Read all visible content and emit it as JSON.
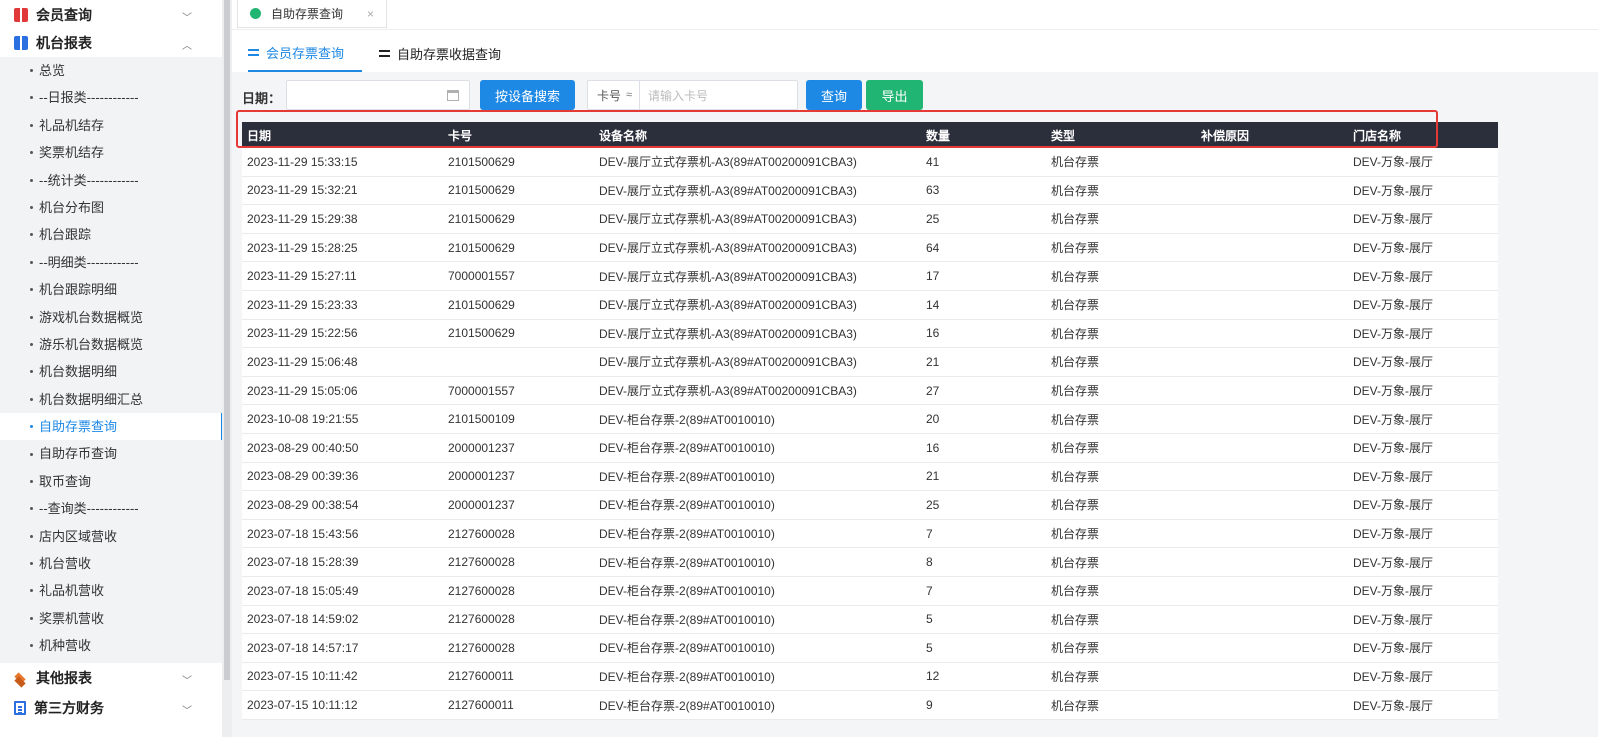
{
  "sidebar": {
    "groups": [
      {
        "label": "会员查询",
        "icon": "red-book-icon",
        "expanded": false
      },
      {
        "label": "机台报表",
        "icon": "blue-book-icon",
        "expanded": true
      },
      {
        "label": "其他报表",
        "icon": "layers-icon",
        "expanded": false
      },
      {
        "label": "第三方财务",
        "icon": "document-icon",
        "expanded": false
      }
    ],
    "items": [
      "总览",
      "--日报类------------",
      "礼品机结存",
      "奖票机结存",
      "--统计类------------",
      "机台分布图",
      "机台跟踪",
      "--明细类------------",
      "机台跟踪明细",
      "游戏机台数据概览",
      "游乐机台数据概览",
      "机台数据明细",
      "机台数据明细汇总",
      "自助存票查询",
      "自助存币查询",
      "取币查询",
      "--查询类------------",
      "店内区域营收",
      "机台营收",
      "礼品机营收",
      "奖票机营收",
      "机种营收"
    ],
    "active_item": "自助存票查询"
  },
  "page_tab": {
    "label": "自助存票查询",
    "close": "×"
  },
  "subtabs": [
    {
      "label": "会员存票查询",
      "active": true
    },
    {
      "label": "自助存票收据查询",
      "active": false
    }
  ],
  "filters": {
    "date_label": "日期：",
    "date_value": "",
    "device_search_button": "按设备搜索",
    "card_select": "卡号",
    "card_select_symbol": "≈",
    "card_placeholder": "请输入卡号",
    "query_button": "查询",
    "export_button": "导出"
  },
  "table": {
    "columns": [
      "日期",
      "卡号",
      "设备名称",
      "数量",
      "类型",
      "补偿原因",
      "门店名称"
    ],
    "rows": [
      [
        "2023-11-29 15:33:15",
        "2101500629",
        "DEV-展厅立式存票机-A3(89#AT00200091CBA3)",
        "41",
        "机台存票",
        "",
        "DEV-万象-展厅"
      ],
      [
        "2023-11-29 15:32:21",
        "2101500629",
        "DEV-展厅立式存票机-A3(89#AT00200091CBA3)",
        "63",
        "机台存票",
        "",
        "DEV-万象-展厅"
      ],
      [
        "2023-11-29 15:29:38",
        "2101500629",
        "DEV-展厅立式存票机-A3(89#AT00200091CBA3)",
        "25",
        "机台存票",
        "",
        "DEV-万象-展厅"
      ],
      [
        "2023-11-29 15:28:25",
        "2101500629",
        "DEV-展厅立式存票机-A3(89#AT00200091CBA3)",
        "64",
        "机台存票",
        "",
        "DEV-万象-展厅"
      ],
      [
        "2023-11-29 15:27:11",
        "7000001557",
        "DEV-展厅立式存票机-A3(89#AT00200091CBA3)",
        "17",
        "机台存票",
        "",
        "DEV-万象-展厅"
      ],
      [
        "2023-11-29 15:23:33",
        "2101500629",
        "DEV-展厅立式存票机-A3(89#AT00200091CBA3)",
        "14",
        "机台存票",
        "",
        "DEV-万象-展厅"
      ],
      [
        "2023-11-29 15:22:56",
        "2101500629",
        "DEV-展厅立式存票机-A3(89#AT00200091CBA3)",
        "16",
        "机台存票",
        "",
        "DEV-万象-展厅"
      ],
      [
        "2023-11-29 15:06:48",
        "",
        "DEV-展厅立式存票机-A3(89#AT00200091CBA3)",
        "21",
        "机台存票",
        "",
        "DEV-万象-展厅"
      ],
      [
        "2023-11-29 15:05:06",
        "7000001557",
        "DEV-展厅立式存票机-A3(89#AT00200091CBA3)",
        "27",
        "机台存票",
        "",
        "DEV-万象-展厅"
      ],
      [
        "2023-10-08 19:21:55",
        "2101500109",
        "DEV-柜台存票-2(89#AT0010010)",
        "20",
        "机台存票",
        "",
        "DEV-万象-展厅"
      ],
      [
        "2023-08-29 00:40:50",
        "2000001237",
        "DEV-柜台存票-2(89#AT0010010)",
        "16",
        "机台存票",
        "",
        "DEV-万象-展厅"
      ],
      [
        "2023-08-29 00:39:36",
        "2000001237",
        "DEV-柜台存票-2(89#AT0010010)",
        "21",
        "机台存票",
        "",
        "DEV-万象-展厅"
      ],
      [
        "2023-08-29 00:38:54",
        "2000001237",
        "DEV-柜台存票-2(89#AT0010010)",
        "25",
        "机台存票",
        "",
        "DEV-万象-展厅"
      ],
      [
        "2023-07-18 15:43:56",
        "2127600028",
        "DEV-柜台存票-2(89#AT0010010)",
        "7",
        "机台存票",
        "",
        "DEV-万象-展厅"
      ],
      [
        "2023-07-18 15:28:39",
        "2127600028",
        "DEV-柜台存票-2(89#AT0010010)",
        "8",
        "机台存票",
        "",
        "DEV-万象-展厅"
      ],
      [
        "2023-07-18 15:05:49",
        "2127600028",
        "DEV-柜台存票-2(89#AT0010010)",
        "7",
        "机台存票",
        "",
        "DEV-万象-展厅"
      ],
      [
        "2023-07-18 14:59:02",
        "2127600028",
        "DEV-柜台存票-2(89#AT0010010)",
        "5",
        "机台存票",
        "",
        "DEV-万象-展厅"
      ],
      [
        "2023-07-18 14:57:17",
        "2127600028",
        "DEV-柜台存票-2(89#AT0010010)",
        "5",
        "机台存票",
        "",
        "DEV-万象-展厅"
      ],
      [
        "2023-07-15 10:11:42",
        "2127600011",
        "DEV-柜台存票-2(89#AT0010010)",
        "12",
        "机台存票",
        "",
        "DEV-万象-展厅"
      ],
      [
        "2023-07-15 10:11:12",
        "2127600011",
        "DEV-柜台存票-2(89#AT0010010)",
        "9",
        "机台存票",
        "",
        "DEV-万象-展厅"
      ]
    ]
  },
  "colors": {
    "accent": "#1e88e5",
    "success": "#21b573",
    "table_header": "#2b2e3b",
    "highlight_box": "#e53935"
  }
}
